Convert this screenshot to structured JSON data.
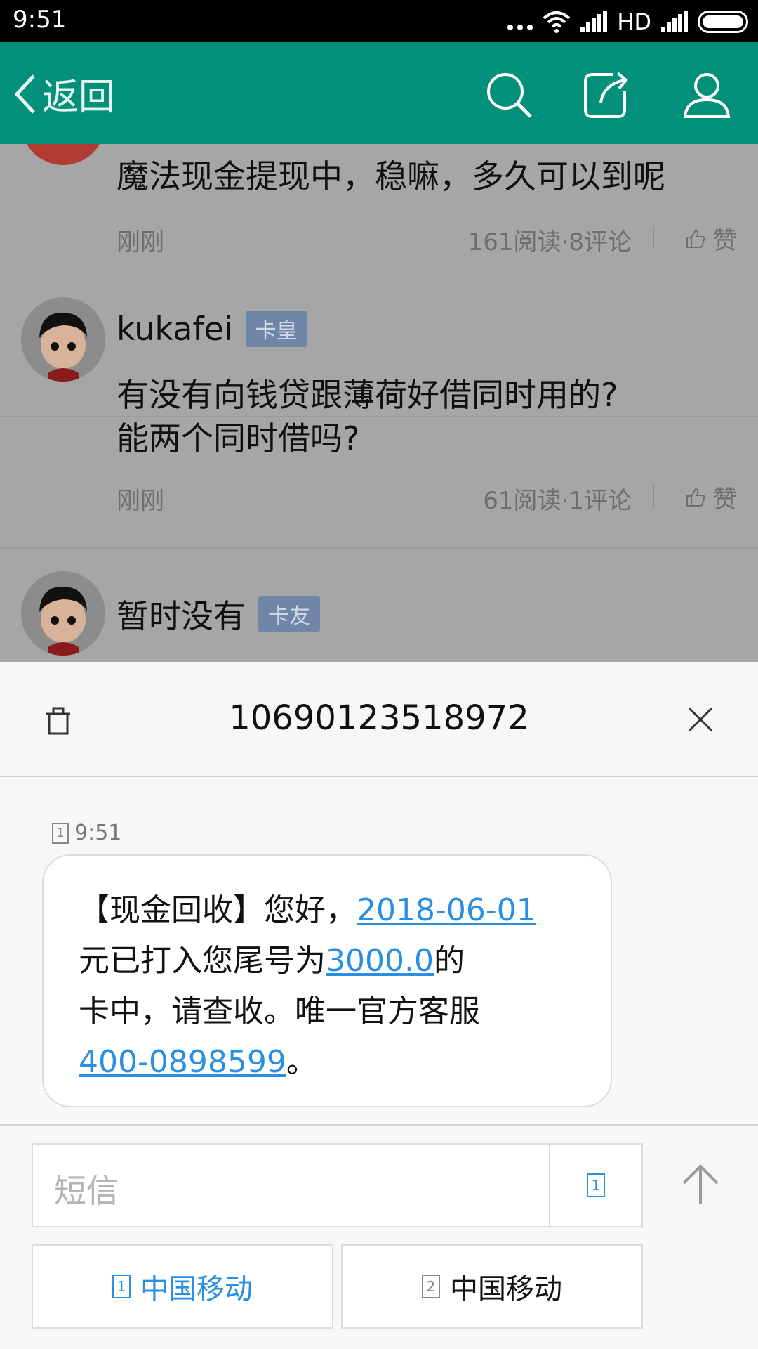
{
  "status_bar": {
    "time": "9:51",
    "network": "HD"
  },
  "header": {
    "back_label": "返回",
    "icons": [
      "search-icon",
      "share-icon",
      "user-icon"
    ],
    "accent_color": "#02907a"
  },
  "feed": {
    "posts": [
      {
        "text": "魔法现金提现中，稳嘛，多久可以到呢",
        "time": "刚刚",
        "stats": "161阅读·8评论",
        "like_label": "赞"
      },
      {
        "username": "kukafei",
        "badge": "卡皇",
        "text_line1": "有没有向钱贷跟薄荷好借同时用的?",
        "text_line2": "能两个同时借吗?",
        "time": "刚刚",
        "stats": "61阅读·1评论",
        "like_label": "赞"
      },
      {
        "username": "暂时没有",
        "badge": "卡友"
      }
    ]
  },
  "sms": {
    "sender_number": "10690123518972",
    "sim_indicator": "1",
    "timestamp": "9:51",
    "message": {
      "part1": "【现金回收】您好，",
      "link1": "2018-06-01",
      "part2": "元已打入您尾号为",
      "link2": "3000.0",
      "part3": "的",
      "part4": "卡中，请查收。唯一官方客服",
      "link3": "400-0898599",
      "part5": "。"
    },
    "input_placeholder": "短信",
    "input_sim": "1",
    "sim_buttons": [
      {
        "slot": "1",
        "label": "中国移动",
        "color": "#2a8fe0"
      },
      {
        "slot": "2",
        "label": "中国移动",
        "color": "#111111"
      }
    ]
  }
}
